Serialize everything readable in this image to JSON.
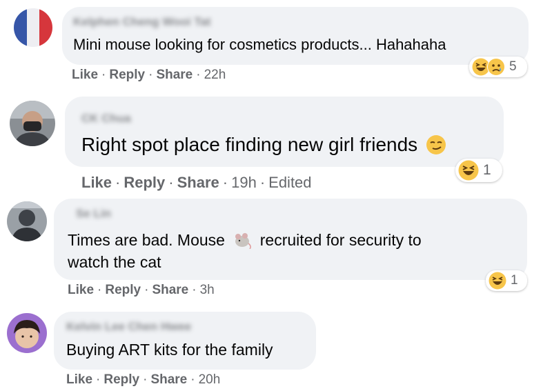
{
  "comments": [
    {
      "author": "Kelphen Cheng Wooi Tat",
      "text": "Mini mouse looking for cosmetics products... Hahahaha",
      "actions": {
        "like": "Like",
        "reply": "Reply",
        "share": "Share",
        "time": "22h"
      },
      "reaction_count": "5"
    },
    {
      "author": "CK Chua",
      "text": "Right spot place finding new girl friends",
      "actions": {
        "like": "Like",
        "reply": "Reply",
        "share": "Share",
        "time": "19h",
        "edited": "Edited"
      },
      "reaction_count": "1"
    },
    {
      "author": "Se Lin",
      "text_line1_before": "Times are bad. Mouse",
      "text_line1_after": "recruited for security to",
      "text_line2": "watch the cat",
      "actions": {
        "like": "Like",
        "reply": "Reply",
        "share": "Share",
        "time": "3h"
      },
      "reaction_count": "1"
    },
    {
      "author": "Kelvin Lee Chen Hwee",
      "text": "Buying ART kits for the family",
      "actions": {
        "like": "Like",
        "reply": "Reply",
        "share": "Share",
        "time": "20h"
      }
    }
  ],
  "colors": {
    "bubble": "#f0f2f5",
    "meta": "#65676b",
    "text": "#050505",
    "emoji": "#f7c54a"
  }
}
